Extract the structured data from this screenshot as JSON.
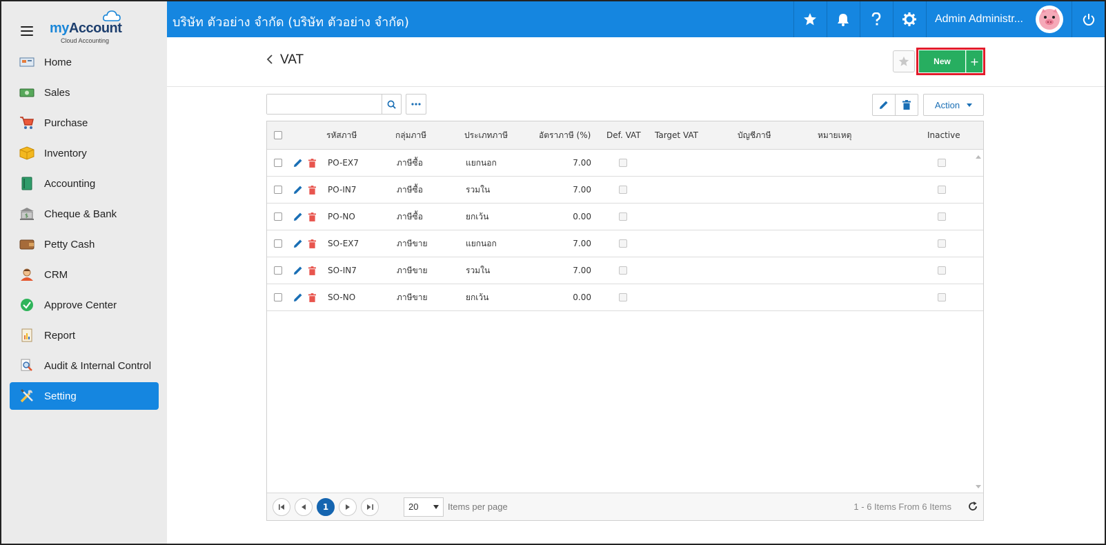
{
  "app": {
    "brand_my": "my",
    "brand_account": "Account",
    "brand_sub": "Cloud Accounting",
    "company": "บริษัท ตัวอย่าง จำกัด (บริษัท ตัวอย่าง จำกัด)",
    "user_name": "Admin Administr..."
  },
  "sidebar": {
    "items": [
      {
        "label": "Home",
        "icon": "home-icon"
      },
      {
        "label": "Sales",
        "icon": "sales-icon"
      },
      {
        "label": "Purchase",
        "icon": "cart-icon"
      },
      {
        "label": "Inventory",
        "icon": "box-icon"
      },
      {
        "label": "Accounting",
        "icon": "book-icon"
      },
      {
        "label": "Cheque & Bank",
        "icon": "bank-icon"
      },
      {
        "label": "Petty Cash",
        "icon": "wallet-icon"
      },
      {
        "label": "CRM",
        "icon": "person-icon"
      },
      {
        "label": "Approve Center",
        "icon": "check-circle-icon"
      },
      {
        "label": "Report",
        "icon": "report-icon"
      },
      {
        "label": "Audit & Internal Control",
        "icon": "magnifier-icon"
      },
      {
        "label": "Setting",
        "icon": "tools-icon",
        "active": true
      }
    ]
  },
  "page": {
    "title": "VAT",
    "new_label": "New",
    "new_plus": "+",
    "action_label": "Action"
  },
  "search": {
    "placeholder": "",
    "value": ""
  },
  "table": {
    "columns": [
      "รหัสภาษี",
      "กลุ่มภาษี",
      "ประเภทภาษี",
      "อัตราภาษี (%)",
      "Def. VAT",
      "Target VAT",
      "บัญชีภาษี",
      "หมายเหตุ",
      "Inactive"
    ],
    "rows": [
      {
        "code": "PO-EX7",
        "group": "ภาษีซื้อ",
        "type": "แยกนอก",
        "rate": "7.00",
        "def_vat": false,
        "target_vat": "",
        "account": "",
        "note": "",
        "inactive": false
      },
      {
        "code": "PO-IN7",
        "group": "ภาษีซื้อ",
        "type": "รวมใน",
        "rate": "7.00",
        "def_vat": false,
        "target_vat": "",
        "account": "",
        "note": "",
        "inactive": false
      },
      {
        "code": "PO-NO",
        "group": "ภาษีซื้อ",
        "type": "ยกเว้น",
        "rate": "0.00",
        "def_vat": false,
        "target_vat": "",
        "account": "",
        "note": "",
        "inactive": false
      },
      {
        "code": "SO-EX7",
        "group": "ภาษีขาย",
        "type": "แยกนอก",
        "rate": "7.00",
        "def_vat": false,
        "target_vat": "",
        "account": "",
        "note": "",
        "inactive": false
      },
      {
        "code": "SO-IN7",
        "group": "ภาษีขาย",
        "type": "รวมใน",
        "rate": "7.00",
        "def_vat": false,
        "target_vat": "",
        "account": "",
        "note": "",
        "inactive": false
      },
      {
        "code": "SO-NO",
        "group": "ภาษีขาย",
        "type": "ยกเว้น",
        "rate": "0.00",
        "def_vat": false,
        "target_vat": "",
        "account": "",
        "note": "",
        "inactive": false
      }
    ]
  },
  "pager": {
    "current_page": "1",
    "per_page": "20",
    "per_page_label": "Items per page",
    "info": "1 - 6 Items From 6 Items"
  },
  "colors": {
    "primary": "#1586e0",
    "new_button": "#27ae60",
    "highlight_border": "#e21c2b",
    "edit_icon": "#1a6fb5",
    "delete_icon": "#e8554e"
  }
}
